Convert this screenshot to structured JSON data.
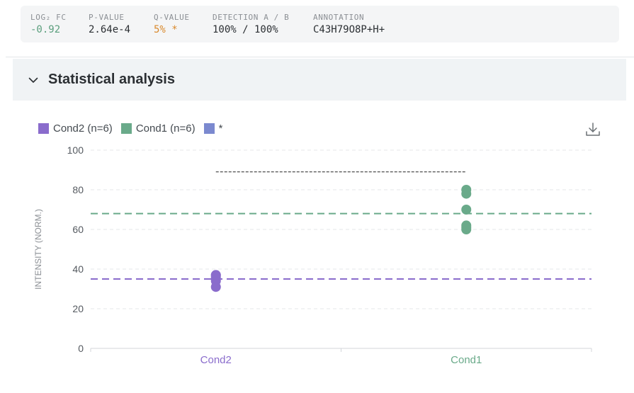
{
  "stats": [
    {
      "label": "LOG₂ FC",
      "value": "-0.92",
      "color": "#5b9f7d"
    },
    {
      "label": "P-VALUE",
      "value": "2.64e-4",
      "color": "#2b2f33"
    },
    {
      "label": "Q-VALUE",
      "value": "5% *",
      "color": "#d9892c"
    },
    {
      "label": "DETECTION A / B",
      "value": "100% / 100%",
      "color": "#2b2f33"
    },
    {
      "label": "ANNOTATION",
      "value": "C43H79O8P+H+",
      "color": "#2b2f33"
    }
  ],
  "section": {
    "title": "Statistical analysis"
  },
  "icons": {
    "collapse": "chevron-down-icon",
    "download": "download-icon"
  },
  "chart_data": {
    "type": "scatter",
    "categories": [
      "Cond2",
      "Cond1"
    ],
    "ylabel": "INTENSITY (NORM.)",
    "ylim": [
      0,
      100
    ],
    "yticks": [
      0,
      20,
      40,
      60,
      80,
      100
    ],
    "grid": true,
    "legend_position": "top-left",
    "series": [
      {
        "name": "Cond2 (n=6)",
        "category": "Cond2",
        "color": "#8a6ccc",
        "values": [
          31,
          34,
          35,
          36,
          37,
          37
        ],
        "mean": 35
      },
      {
        "name": "Cond1 (n=6)",
        "category": "Cond1",
        "color": "#6aaa8a",
        "values": [
          60,
          61,
          62,
          70,
          78,
          80
        ],
        "mean": 68
      }
    ],
    "significance": {
      "label": "*",
      "color": "#7b89cf",
      "from": "Cond2",
      "to": "Cond1",
      "y": 89
    }
  }
}
